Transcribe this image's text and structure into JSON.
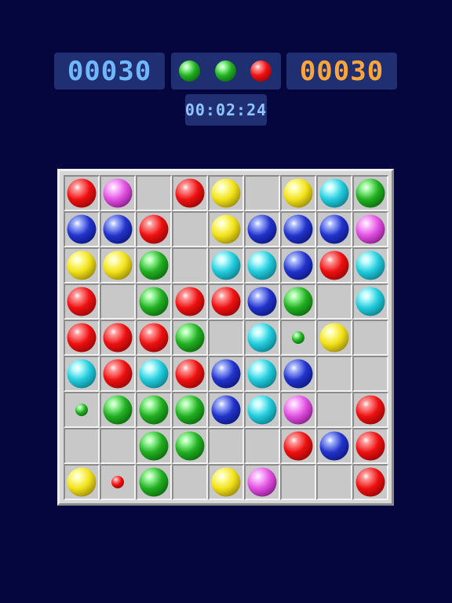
{
  "score": "00030",
  "high_score": "00030",
  "timer": "00:02:24",
  "colors": {
    "score_digits": "#6fb7ff",
    "high_score_digits": "#ffa63a",
    "timer_digits": "#8fc4ff",
    "panel_bg": "#1f2f72",
    "background": "#06063f",
    "balls": {
      "red": [
        "#ff9a9a",
        "#ee1010",
        "#6a0000"
      ],
      "magenta": [
        "#ffc6ff",
        "#e050e0",
        "#5a005a"
      ],
      "yellow": [
        "#ffffb0",
        "#f2e21a",
        "#6a5a00"
      ],
      "cyan": [
        "#c6ffff",
        "#22ccdd",
        "#005560"
      ],
      "green": [
        "#aaffaa",
        "#22b022",
        "#004400"
      ],
      "blue": [
        "#a8b8ff",
        "#2233cc",
        "#000a55"
      ]
    }
  },
  "next_balls": [
    "green",
    "green",
    "red"
  ],
  "board": [
    [
      "red",
      "magenta",
      "",
      "red",
      "yellow",
      "",
      "yellow",
      "cyan",
      "green"
    ],
    [
      "blue",
      "blue",
      "red",
      "",
      "yellow",
      "blue",
      "blue",
      "blue",
      "magenta"
    ],
    [
      "yellow",
      "yellow",
      "green",
      "",
      "cyan",
      "cyan",
      "blue",
      "red",
      "cyan"
    ],
    [
      "red",
      "",
      "green",
      "red",
      "red",
      "blue",
      "green",
      "",
      "cyan"
    ],
    [
      "red",
      "red",
      "red",
      "green",
      "",
      "cyan",
      "green:small",
      "yellow",
      ""
    ],
    [
      "cyan",
      "red",
      "cyan",
      "red",
      "blue",
      "cyan",
      "blue",
      "",
      ""
    ],
    [
      "green:small",
      "green",
      "green",
      "green",
      "blue",
      "cyan",
      "magenta",
      "",
      "red"
    ],
    [
      "",
      "",
      "green",
      "green",
      "",
      "",
      "red",
      "blue",
      "red"
    ],
    [
      "yellow",
      "red:small",
      "green",
      "",
      "yellow",
      "magenta",
      "",
      "",
      "red"
    ]
  ]
}
